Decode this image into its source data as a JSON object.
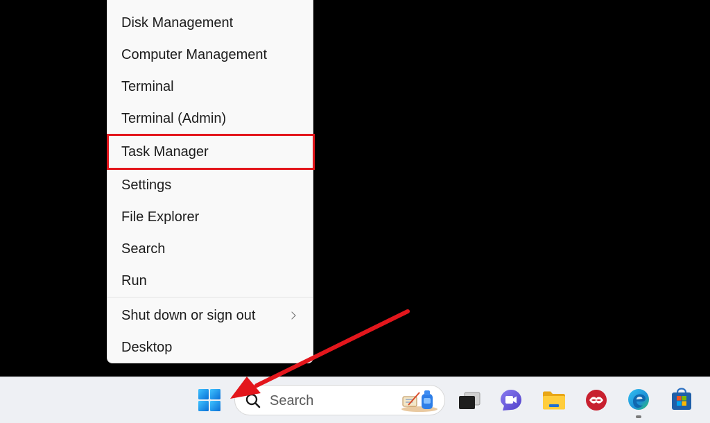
{
  "context_menu": {
    "items": [
      {
        "label": "Disk Management"
      },
      {
        "label": "Computer Management"
      },
      {
        "label": "Terminal"
      },
      {
        "label": "Terminal (Admin)"
      },
      {
        "label": "Task Manager"
      },
      {
        "label": "Settings"
      },
      {
        "label": "File Explorer"
      },
      {
        "label": "Search"
      },
      {
        "label": "Run"
      },
      {
        "label": "Shut down or sign out"
      },
      {
        "label": "Desktop"
      }
    ],
    "highlighted_item": "Task Manager",
    "highlight_color": "#e3161c"
  },
  "taskbar": {
    "search_placeholder": "Search",
    "pinned_icons": [
      "windows-start-icon",
      "task-view-icon",
      "meet-camera-icon",
      "file-explorer-icon",
      "red-app-icon",
      "edge-icon",
      "microsoft-store-icon"
    ]
  },
  "annotation": {
    "arrow_color": "#e3161c",
    "points_to": "start-button"
  }
}
